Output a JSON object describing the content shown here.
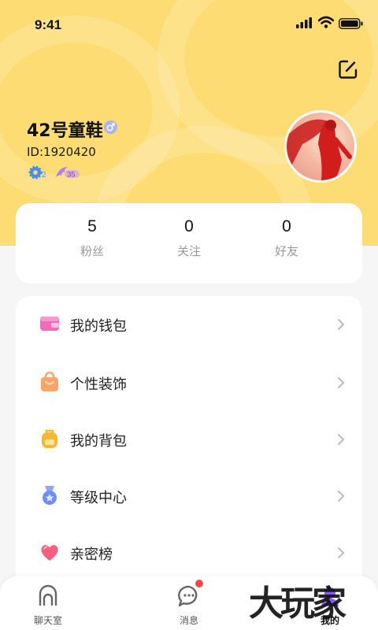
{
  "status_bar": {
    "time": "9:41"
  },
  "profile": {
    "nickname": "42号童鞋",
    "gender_icon": "male-icon",
    "user_id": "ID:1920420",
    "badges": [
      {
        "icon": "level-gear-icon",
        "value": "2"
      },
      {
        "icon": "wing-badge-icon",
        "value": "35"
      }
    ]
  },
  "stats": [
    {
      "value": "5",
      "label": "粉丝"
    },
    {
      "value": "0",
      "label": "关注"
    },
    {
      "value": "0",
      "label": "好友"
    }
  ],
  "menu": [
    {
      "label": "我的钱包",
      "icon": "wallet-icon",
      "color": "#f36bb6"
    },
    {
      "label": "个性装饰",
      "icon": "shopping-bag-icon",
      "color": "#f7a46d"
    },
    {
      "label": "我的背包",
      "icon": "backpack-icon",
      "color": "#f5b82e"
    },
    {
      "label": "等级中心",
      "icon": "medal-icon",
      "color": "#6f8ef5"
    },
    {
      "label": "亲密榜",
      "icon": "heart-icon",
      "color": "#f5607e"
    }
  ],
  "bottom_nav": [
    {
      "label": "聊天室",
      "icon": "chatroom-icon"
    },
    {
      "label": "消息",
      "icon": "message-icon"
    },
    {
      "label": "我的",
      "icon": "profile-icon",
      "active": true
    }
  ],
  "watermark": "大玩家",
  "colors": {
    "header": "#fddd73",
    "accent": "#8a5cf6"
  }
}
